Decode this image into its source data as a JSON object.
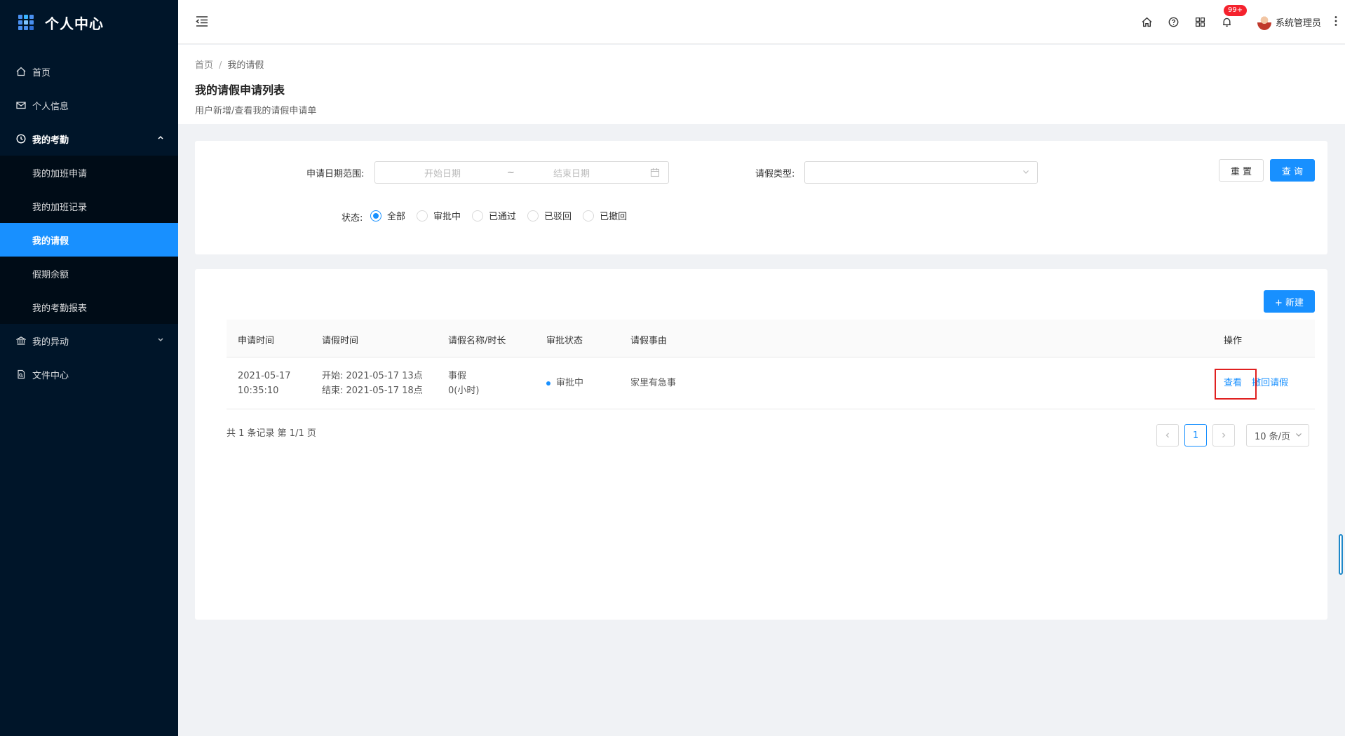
{
  "app": {
    "title": "个人中心"
  },
  "sidebar": {
    "items": [
      {
        "label": "首页",
        "icon": "home-icon"
      },
      {
        "label": "个人信息",
        "icon": "mail-icon"
      },
      {
        "label": "我的考勤",
        "icon": "clock-icon",
        "open": true,
        "children": [
          {
            "label": "我的加班申请"
          },
          {
            "label": "我的加班记录"
          },
          {
            "label": "我的请假",
            "active": true
          },
          {
            "label": "假期余额"
          },
          {
            "label": "我的考勤报表"
          }
        ]
      },
      {
        "label": "我的异动",
        "icon": "bank-icon"
      },
      {
        "label": "文件中心",
        "icon": "file-icon"
      }
    ]
  },
  "header": {
    "notification_badge": "99+",
    "user_name": "系统管理员"
  },
  "page": {
    "breadcrumb": [
      "首页",
      "/",
      "我的请假"
    ],
    "title": "我的请假申请列表",
    "description": "用户新增/查看我的请假申请单"
  },
  "filter": {
    "date_range_label": "申请日期范围:",
    "start_placeholder": "开始日期",
    "tilde": "~",
    "end_placeholder": "结束日期",
    "leave_type_label": "请假类型:",
    "leave_type_value": "",
    "reset_label": "重 置",
    "query_label": "查 询",
    "status_label": "状态:",
    "status_options": [
      "全部",
      "审批中",
      "已通过",
      "已驳回",
      "已撤回"
    ],
    "status_selected": 0
  },
  "table": {
    "new_label": "+ 新建",
    "columns": [
      "申请时间",
      "请假时间",
      "请假名称/时长",
      "审批状态",
      "请假事由",
      "操作"
    ],
    "rows": [
      {
        "apply_time_1": "2021-05-17",
        "apply_time_2": "10:35:10",
        "leave_start": "开始: 2021-05-17 13点",
        "leave_end": "结束: 2021-05-17 18点",
        "leave_name": "事假",
        "leave_duration": "0(小时)",
        "status": "审批中",
        "reason": "家里有急事",
        "op_view": "查看",
        "op_withdraw": "撤回请假"
      }
    ],
    "total_text": "共 1 条记录 第 1/1 页",
    "current_page": "1",
    "page_size": "10 条/页"
  },
  "colors": {
    "primary": "#1890ff",
    "sidebar_bg": "#001529",
    "highlight": "#e02020"
  }
}
